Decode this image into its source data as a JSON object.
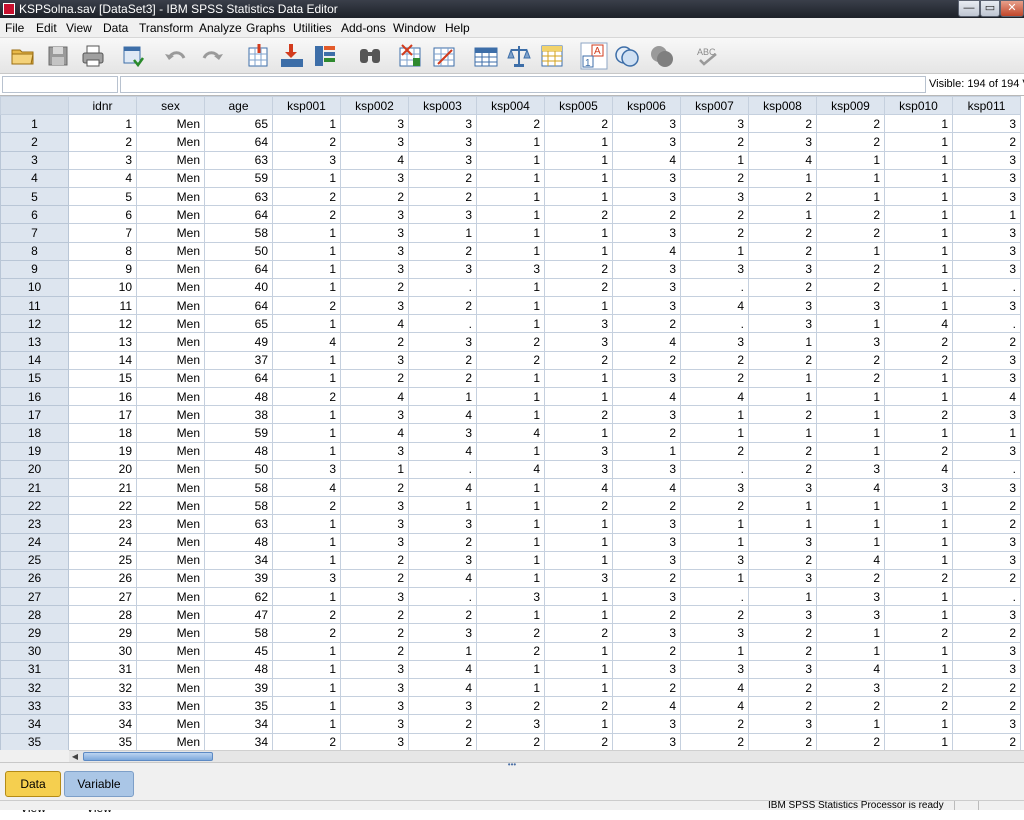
{
  "window": {
    "title": "KSPSolna.sav [DataSet3] - IBM SPSS Statistics Data Editor",
    "controls": {
      "minimize": "—",
      "maximize": "▭",
      "close": "✕"
    }
  },
  "menu": [
    "File",
    "Edit",
    "View",
    "Data",
    "Transform",
    "Analyze",
    "Graphs",
    "Utilities",
    "Add-ons",
    "Window",
    "Help"
  ],
  "toolbar_icons": [
    "open-folder-icon",
    "save-icon",
    "print-icon",
    "recall-dialog-icon",
    "undo-icon",
    "redo-icon",
    "go-to-case-icon",
    "go-to-variable-icon",
    "variables-icon",
    "find-icon",
    "insert-cases-icon",
    "insert-variable-icon",
    "split-file-icon",
    "weight-cases-icon",
    "select-cases-icon",
    "value-labels-icon",
    "use-variable-sets-icon",
    "show-all-variables-icon",
    "spell-check-icon"
  ],
  "cell_editor": {
    "name": "",
    "value": ""
  },
  "visible_count": "Visible: 194 of 194 Va",
  "grid": {
    "columns": [
      "idnr",
      "sex",
      "age",
      "ksp001",
      "ksp002",
      "ksp003",
      "ksp004",
      "ksp005",
      "ksp006",
      "ksp007",
      "ksp008",
      "ksp009",
      "ksp010",
      "ksp011"
    ],
    "rows": [
      [
        "1",
        "1",
        "Men",
        "65",
        "1",
        "3",
        "3",
        "2",
        "2",
        "3",
        "3",
        "2",
        "2",
        "1",
        "3"
      ],
      [
        "2",
        "2",
        "Men",
        "64",
        "2",
        "3",
        "3",
        "1",
        "1",
        "3",
        "2",
        "3",
        "2",
        "1",
        "2"
      ],
      [
        "3",
        "3",
        "Men",
        "63",
        "3",
        "4",
        "3",
        "1",
        "1",
        "4",
        "1",
        "4",
        "1",
        "1",
        "3"
      ],
      [
        "4",
        "4",
        "Men",
        "59",
        "1",
        "3",
        "2",
        "1",
        "1",
        "3",
        "2",
        "1",
        "1",
        "1",
        "3"
      ],
      [
        "5",
        "5",
        "Men",
        "63",
        "2",
        "2",
        "2",
        "1",
        "1",
        "3",
        "3",
        "2",
        "1",
        "1",
        "3"
      ],
      [
        "6",
        "6",
        "Men",
        "64",
        "2",
        "3",
        "3",
        "1",
        "2",
        "2",
        "2",
        "1",
        "2",
        "1",
        "1"
      ],
      [
        "7",
        "7",
        "Men",
        "58",
        "1",
        "3",
        "1",
        "1",
        "1",
        "3",
        "2",
        "2",
        "2",
        "1",
        "3"
      ],
      [
        "8",
        "8",
        "Men",
        "50",
        "1",
        "3",
        "2",
        "1",
        "1",
        "4",
        "1",
        "2",
        "1",
        "1",
        "3"
      ],
      [
        "9",
        "9",
        "Men",
        "64",
        "1",
        "3",
        "3",
        "3",
        "2",
        "3",
        "3",
        "3",
        "2",
        "1",
        "3"
      ],
      [
        "10",
        "10",
        "Men",
        "40",
        "1",
        "2",
        ".",
        "1",
        "2",
        "3",
        ".",
        "2",
        "2",
        "1",
        "."
      ],
      [
        "11",
        "11",
        "Men",
        "64",
        "2",
        "3",
        "2",
        "1",
        "1",
        "3",
        "4",
        "3",
        "3",
        "1",
        "3"
      ],
      [
        "12",
        "12",
        "Men",
        "65",
        "1",
        "4",
        ".",
        "1",
        "3",
        "2",
        ".",
        "3",
        "1",
        "4",
        "."
      ],
      [
        "13",
        "13",
        "Men",
        "49",
        "4",
        "2",
        "3",
        "2",
        "3",
        "4",
        "3",
        "1",
        "3",
        "2",
        "2"
      ],
      [
        "14",
        "14",
        "Men",
        "37",
        "1",
        "3",
        "2",
        "2",
        "2",
        "2",
        "2",
        "2",
        "2",
        "2",
        "3"
      ],
      [
        "15",
        "15",
        "Men",
        "64",
        "1",
        "2",
        "2",
        "1",
        "1",
        "3",
        "2",
        "1",
        "2",
        "1",
        "3"
      ],
      [
        "16",
        "16",
        "Men",
        "48",
        "2",
        "4",
        "1",
        "1",
        "1",
        "4",
        "4",
        "1",
        "1",
        "1",
        "4"
      ],
      [
        "17",
        "17",
        "Men",
        "38",
        "1",
        "3",
        "4",
        "1",
        "2",
        "3",
        "1",
        "2",
        "1",
        "2",
        "3"
      ],
      [
        "18",
        "18",
        "Men",
        "59",
        "1",
        "4",
        "3",
        "4",
        "1",
        "2",
        "1",
        "1",
        "1",
        "1",
        "1"
      ],
      [
        "19",
        "19",
        "Men",
        "48",
        "1",
        "3",
        "4",
        "1",
        "3",
        "1",
        "2",
        "2",
        "1",
        "2",
        "3"
      ],
      [
        "20",
        "20",
        "Men",
        "50",
        "3",
        "1",
        ".",
        "4",
        "3",
        "3",
        ".",
        "2",
        "3",
        "4",
        "."
      ],
      [
        "21",
        "21",
        "Men",
        "58",
        "4",
        "2",
        "4",
        "1",
        "4",
        "4",
        "3",
        "3",
        "4",
        "3",
        "3"
      ],
      [
        "22",
        "22",
        "Men",
        "58",
        "2",
        "3",
        "1",
        "1",
        "2",
        "2",
        "2",
        "1",
        "1",
        "1",
        "2"
      ],
      [
        "23",
        "23",
        "Men",
        "63",
        "1",
        "3",
        "3",
        "1",
        "1",
        "3",
        "1",
        "1",
        "1",
        "1",
        "2"
      ],
      [
        "24",
        "24",
        "Men",
        "48",
        "1",
        "3",
        "2",
        "1",
        "1",
        "3",
        "1",
        "3",
        "1",
        "1",
        "3"
      ],
      [
        "25",
        "25",
        "Men",
        "34",
        "1",
        "2",
        "3",
        "1",
        "1",
        "3",
        "3",
        "2",
        "4",
        "1",
        "3"
      ],
      [
        "26",
        "26",
        "Men",
        "39",
        "3",
        "2",
        "4",
        "1",
        "3",
        "2",
        "1",
        "3",
        "2",
        "2",
        "2"
      ],
      [
        "27",
        "27",
        "Men",
        "62",
        "1",
        "3",
        ".",
        "3",
        "1",
        "3",
        ".",
        "1",
        "3",
        "1",
        "."
      ],
      [
        "28",
        "28",
        "Men",
        "47",
        "2",
        "2",
        "2",
        "1",
        "1",
        "2",
        "2",
        "3",
        "3",
        "1",
        "3"
      ],
      [
        "29",
        "29",
        "Men",
        "58",
        "2",
        "2",
        "3",
        "2",
        "2",
        "3",
        "3",
        "2",
        "1",
        "2",
        "2"
      ],
      [
        "30",
        "30",
        "Men",
        "45",
        "1",
        "2",
        "1",
        "2",
        "1",
        "2",
        "1",
        "2",
        "1",
        "1",
        "3"
      ],
      [
        "31",
        "31",
        "Men",
        "48",
        "1",
        "3",
        "4",
        "1",
        "1",
        "3",
        "3",
        "3",
        "4",
        "1",
        "3"
      ],
      [
        "32",
        "32",
        "Men",
        "39",
        "1",
        "3",
        "4",
        "1",
        "1",
        "2",
        "4",
        "2",
        "3",
        "2",
        "2"
      ],
      [
        "33",
        "33",
        "Men",
        "35",
        "1",
        "3",
        "3",
        "2",
        "2",
        "4",
        "4",
        "2",
        "2",
        "2",
        "2"
      ],
      [
        "34",
        "34",
        "Men",
        "34",
        "1",
        "3",
        "2",
        "3",
        "1",
        "3",
        "2",
        "3",
        "1",
        "1",
        "3"
      ],
      [
        "35",
        "35",
        "Men",
        "34",
        "2",
        "3",
        "2",
        "2",
        "2",
        "3",
        "2",
        "2",
        "2",
        "1",
        "2"
      ]
    ]
  },
  "tabs": {
    "data_view": "Data View",
    "variable_view": "Variable View",
    "splitter": "•••"
  },
  "status": {
    "text": "IBM SPSS Statistics Processor is ready"
  },
  "colors": {
    "active_tab": "#f5cf4f",
    "inactive_tab": "#aac6e6",
    "header_bg": "#dde5ef",
    "scroll_thumb": "#7ea9dc"
  }
}
